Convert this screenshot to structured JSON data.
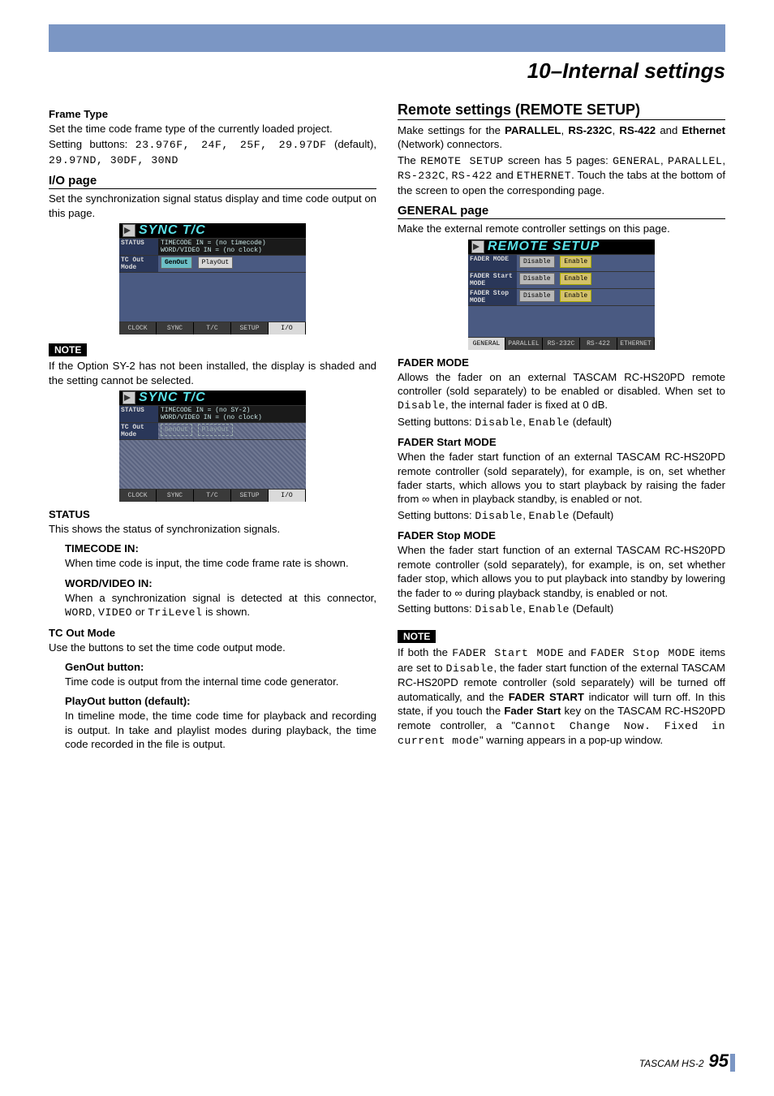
{
  "chapter_title": "10–Internal settings",
  "left": {
    "frame_type": {
      "heading": "Frame Type",
      "p1": "Set the time code frame type of the currently loaded project.",
      "p2a": "Setting buttons: ",
      "p2b": "23.976F, 24F, 25F, 29.97DF",
      "p2c": " (default), ",
      "p2d": "29.97ND, 30DF, 30ND"
    },
    "io_page": {
      "heading": "I/O page",
      "p1": "Set the synchronization signal status display and time code output on this page."
    },
    "ss1": {
      "title": "SYNC T/C",
      "status_label": "STATUS",
      "status_body1": "TIMECODE   IN = (no timecode)",
      "status_body2": "WORD/VIDEO IN = (no clock)",
      "tc_label": "TC Out\nMode",
      "btn_gen": "GenOut",
      "btn_play": "PlayOut",
      "tab_clock": "CLOCK",
      "tab_sync": "SYNC",
      "tab_tc": "T/C",
      "tab_setup": "SETUP",
      "tab_io": "I/O"
    },
    "note1_label": "NOTE",
    "note1_text": "If the Option SY-2 has not been installed, the display is shaded and the setting cannot be selected.",
    "ss2": {
      "title": "SYNC T/C",
      "status_label": "STATUS",
      "status_body1": "TIMECODE   IN = (no SY-2)",
      "status_body2": "WORD/VIDEO IN = (no clock)",
      "tc_label": "TC Out\nMode",
      "btn_gen": "GenOut",
      "btn_play": "PlayOut",
      "tab_clock": "CLOCK",
      "tab_sync": "SYNC",
      "tab_tc": "T/C",
      "tab_setup": "SETUP",
      "tab_io": "I/O"
    },
    "status": {
      "heading": "STATUS",
      "p1": "This shows the status of synchronization signals.",
      "tin_h": "TIMECODE IN:",
      "tin_p": "When time code is input, the time code frame rate is shown.",
      "wvin_h": "WORD/VIDEO IN:",
      "wvin_p1": "When a synchronization signal is detected at this connector, ",
      "wvin_mono1": "WORD",
      "wvin_sep1": ", ",
      "wvin_mono2": "VIDEO",
      "wvin_sep2": " or ",
      "wvin_mono3": "TriLevel",
      "wvin_tail": " is shown."
    },
    "tcout": {
      "heading": "TC Out Mode",
      "p1": "Use the buttons to set the time code output mode.",
      "gen_h": "GenOut button:",
      "gen_p": "Time code is output from the internal time code generator.",
      "play_h": "PlayOut button (default):",
      "play_p": "In timeline mode, the time code time for playback and recording is output. In take and playlist modes during playback, the time code recorded in the file is output."
    }
  },
  "right": {
    "remote": {
      "heading": "Remote settings (REMOTE SETUP)",
      "p1a": "Make settings for the ",
      "p1b": "PARALLEL",
      "p1c": ", ",
      "p1d": "RS-232C",
      "p1e": ", ",
      "p1f": "RS-422",
      "p1g": " and ",
      "p1h": "Ethernet",
      "p1i": " (Network) connectors.",
      "p2a": "The ",
      "p2b": "REMOTE SETUP",
      "p2c": " screen has 5 pages: ",
      "p2d": "GENERAL",
      "p2e": ", ",
      "p2f": "PARALLEL",
      "p2g": ", ",
      "p2h": "RS-232C",
      "p2i": ", ",
      "p2j": "RS-422",
      "p2k": " and ",
      "p2l": "ETHERNET",
      "p2m": ". Touch the tabs at the bottom of the screen to open the corresponding page."
    },
    "general": {
      "heading": "GENERAL page",
      "p1": "Make the external remote controller settings on this page."
    },
    "ss3": {
      "title": "REMOTE SETUP",
      "row1_label": "FADER MODE",
      "row2_label": "FADER Start\nMODE",
      "row3_label": "FADER Stop\nMODE",
      "btn_dis": "Disable",
      "btn_en": "Enable",
      "tab_general": "GENERAL",
      "tab_parallel": "PARALLEL",
      "tab_rs232": "RS-232C",
      "tab_rs422": "RS-422",
      "tab_eth": "ETHERNET"
    },
    "fader_mode": {
      "heading": "FADER MODE",
      "p1a": "Allows the fader on an external TASCAM RC-HS20PD remote controller (sold separately) to be enabled or disabled. When set to ",
      "p1b": "Disable",
      "p1c": ", the internal fader is fixed at 0 dB.",
      "p2a": "Setting buttons: ",
      "p2b": "Disable",
      "p2c": ", ",
      "p2d": "Enable",
      "p2e": " (default)"
    },
    "fader_start": {
      "heading": "FADER Start MODE",
      "p1": "When the fader start function of an external TASCAM RC-HS20PD remote controller (sold separately), for example, is on, set whether fader starts, which allows you to start playback by raising the fader from ∞ when in playback standby, is enabled or not.",
      "p2a": "Setting buttons: ",
      "p2b": "Disable",
      "p2c": ", ",
      "p2d": "Enable",
      "p2e": " (Default)"
    },
    "fader_stop": {
      "heading": "FADER Stop MODE",
      "p1": "When the fader start function of an external TASCAM RC-HS20PD remote controller (sold separately), for example, is on, set whether fader stop, which allows you to put playback into standby by lowering the fader to ∞ during playback standby, is enabled or not.",
      "p2a": "Setting buttons: ",
      "p2b": "Disable",
      "p2c": ", ",
      "p2d": "Enable",
      "p2e": " (Default)"
    },
    "note2_label": "NOTE",
    "note2": {
      "a": "If both the ",
      "b": "FADER Start MODE",
      "c": " and ",
      "d": "FADER Stop MODE",
      "e": " items are set to ",
      "f": "Disable",
      "g": ", the fader start function of the external TASCAM RC-HS20PD remote controller (sold separately) will be turned off automatically, and the ",
      "h": "FADER START",
      "i": " indicator will turn off. In this state, if you touch the ",
      "j": "Fader Start",
      "k": " key on the TASCAM RC-HS20PD remote controller, a \"",
      "l": "Cannot Change Now. Fixed in current mode",
      "m": "\" warning appears in a pop-up window."
    }
  },
  "footer": {
    "model": "TASCAM HS-2",
    "page": "95"
  }
}
